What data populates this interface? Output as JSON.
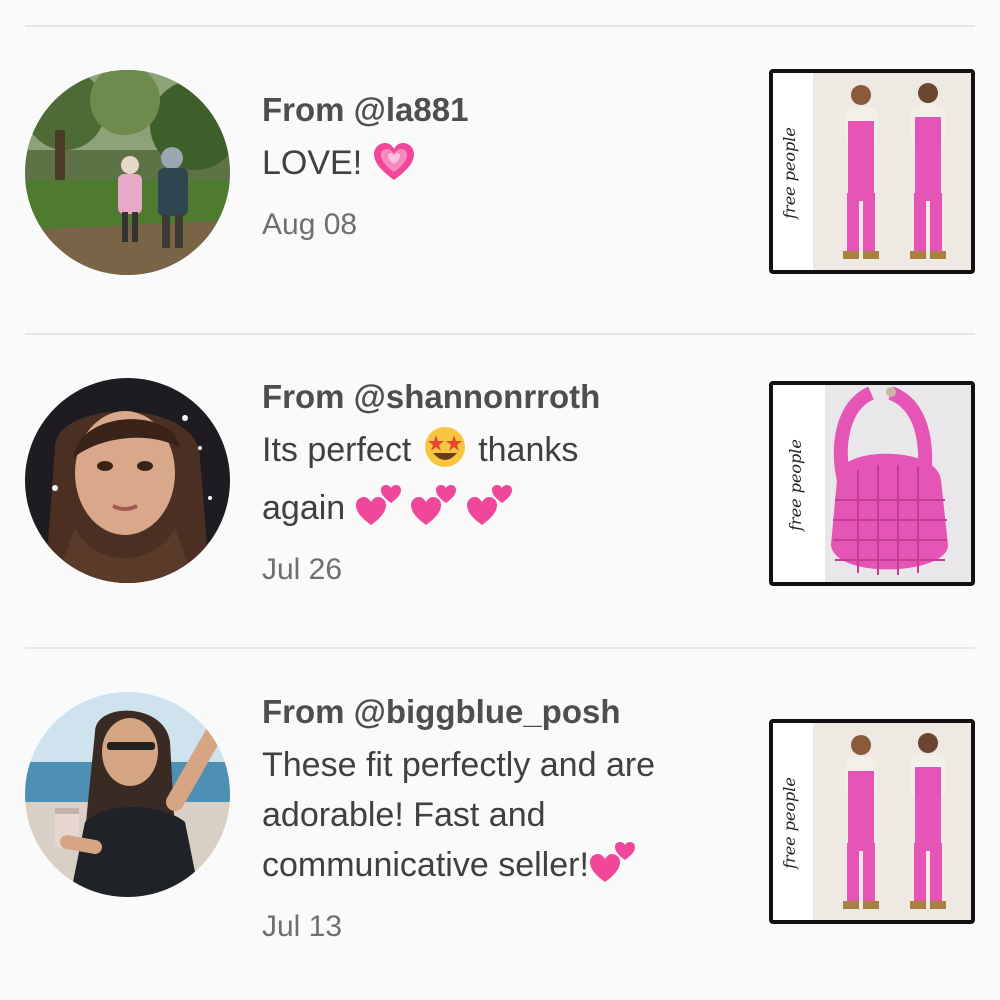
{
  "reviews": [
    {
      "from": "From @la881",
      "message": "LOVE!",
      "date": "Aug 08",
      "avatar_icon": "forest-kids-photo",
      "product_icon": "pink-overalls-photo",
      "product_brand": "free people"
    },
    {
      "from": "From @shannonrroth",
      "message_part1": "Its perfect",
      "message_part2": "thanks",
      "message_part3": "again",
      "date": "Jul 26",
      "avatar_icon": "woman-portrait-photo",
      "product_icon": "pink-quilted-bag-photo",
      "product_brand": "free people"
    },
    {
      "from": "From @biggblue_posh",
      "message": "These fit perfectly and are adorable! Fast and communicative seller!",
      "date": "Jul 13",
      "avatar_icon": "beach-woman-photo",
      "product_icon": "pink-overalls-photo",
      "product_brand": "free people"
    }
  ],
  "colors": {
    "background": "#fbfafb",
    "divider": "#e9e6e9",
    "heart_pink": "#f0479a",
    "product_pink": "#e455b6"
  }
}
